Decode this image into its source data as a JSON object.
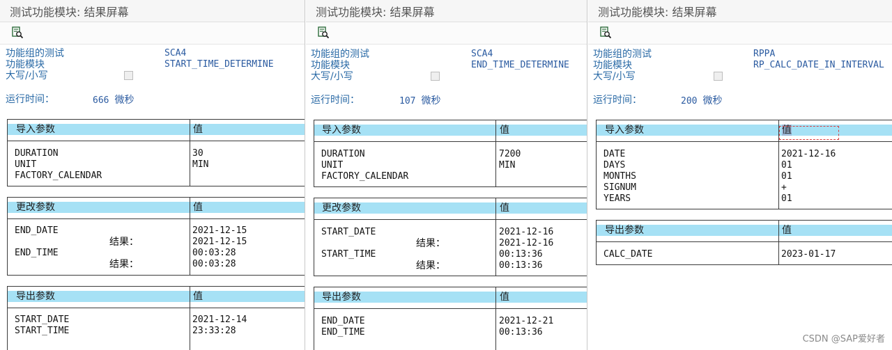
{
  "watermark": "CSDN @SAP爱好者",
  "icons": {
    "toolbar": "document-search-icon"
  },
  "colors": {
    "header_band": "#a6e1f5",
    "label_blue": "#2a6aa6"
  },
  "panels": [
    {
      "title": "测试功能模块: 结果屏幕",
      "header": {
        "fg_label": "功能组的测试",
        "fg_value": "SCA4",
        "fm_label": "功能模块",
        "fm_value": "START_TIME_DETERMINE",
        "case_label": "大写/小写"
      },
      "runtime": {
        "label": "运行时间：",
        "value": "666",
        "unit": "微秒"
      },
      "tables": [
        {
          "title": "导入参数",
          "value_header": "值",
          "rows": [
            {
              "name": "DURATION",
              "value": "30"
            },
            {
              "name": "UNIT",
              "value": "MIN"
            },
            {
              "name": "FACTORY_CALENDAR",
              "value": ""
            }
          ]
        },
        {
          "title": "更改参数",
          "value_header": "值",
          "rows": [
            {
              "name": "END_DATE",
              "value": "2021-12-15"
            },
            {
              "name": "结果：",
              "value": "2021-12-15",
              "result": true
            },
            {
              "name": "END_TIME",
              "value": "00:03:28"
            },
            {
              "name": "结果：",
              "value": "00:03:28",
              "result": true
            }
          ]
        },
        {
          "title": "导出参数",
          "value_header": "值",
          "rows": [
            {
              "name": "START_DATE",
              "value": "2021-12-14"
            },
            {
              "name": "START_TIME",
              "value": "23:33:28"
            }
          ]
        }
      ]
    },
    {
      "title": "测试功能模块: 结果屏幕",
      "header": {
        "fg_label": "功能组的测试",
        "fg_value": "SCA4",
        "fm_label": "功能模块",
        "fm_value": "END_TIME_DETERMINE",
        "case_label": "大写/小写"
      },
      "runtime": {
        "label": "运行时间：",
        "value": "107",
        "unit": "微秒"
      },
      "tables": [
        {
          "title": "导入参数",
          "value_header": "值",
          "rows": [
            {
              "name": "DURATION",
              "value": "7200"
            },
            {
              "name": "UNIT",
              "value": "MIN"
            },
            {
              "name": "FACTORY_CALENDAR",
              "value": ""
            }
          ]
        },
        {
          "title": "更改参数",
          "value_header": "值",
          "rows": [
            {
              "name": "START_DATE",
              "value": "2021-12-16"
            },
            {
              "name": "结果：",
              "value": "2021-12-16",
              "result": true
            },
            {
              "name": "START_TIME",
              "value": "00:13:36"
            },
            {
              "name": "结果：",
              "value": "00:13:36",
              "result": true
            }
          ]
        },
        {
          "title": "导出参数",
          "value_header": "值",
          "rows": [
            {
              "name": "END_DATE",
              "value": "2021-12-21"
            },
            {
              "name": "END_TIME",
              "value": "00:13:36"
            }
          ]
        }
      ]
    },
    {
      "title": "测试功能模块: 结果屏幕",
      "header": {
        "fg_label": "功能组的测试",
        "fg_value": "RPPA",
        "fm_label": "功能模块",
        "fm_value": "RP_CALC_DATE_IN_INTERVAL",
        "case_label": "大写/小写"
      },
      "runtime": {
        "label": "运行时间：",
        "value": "200",
        "unit": "微秒"
      },
      "tables": [
        {
          "title": "导入参数",
          "value_header": "值",
          "rows": [
            {
              "name": "DATE",
              "value": "2021-12-16"
            },
            {
              "name": "DAYS",
              "value": "01"
            },
            {
              "name": "MONTHS",
              "value": "01"
            },
            {
              "name": "SIGNUM",
              "value": "+"
            },
            {
              "name": "YEARS",
              "value": "01"
            }
          ]
        },
        {
          "title": "导出参数",
          "value_header": "值",
          "rows": [
            {
              "name": "CALC_DATE",
              "value": "2023-01-17"
            }
          ]
        }
      ]
    }
  ]
}
